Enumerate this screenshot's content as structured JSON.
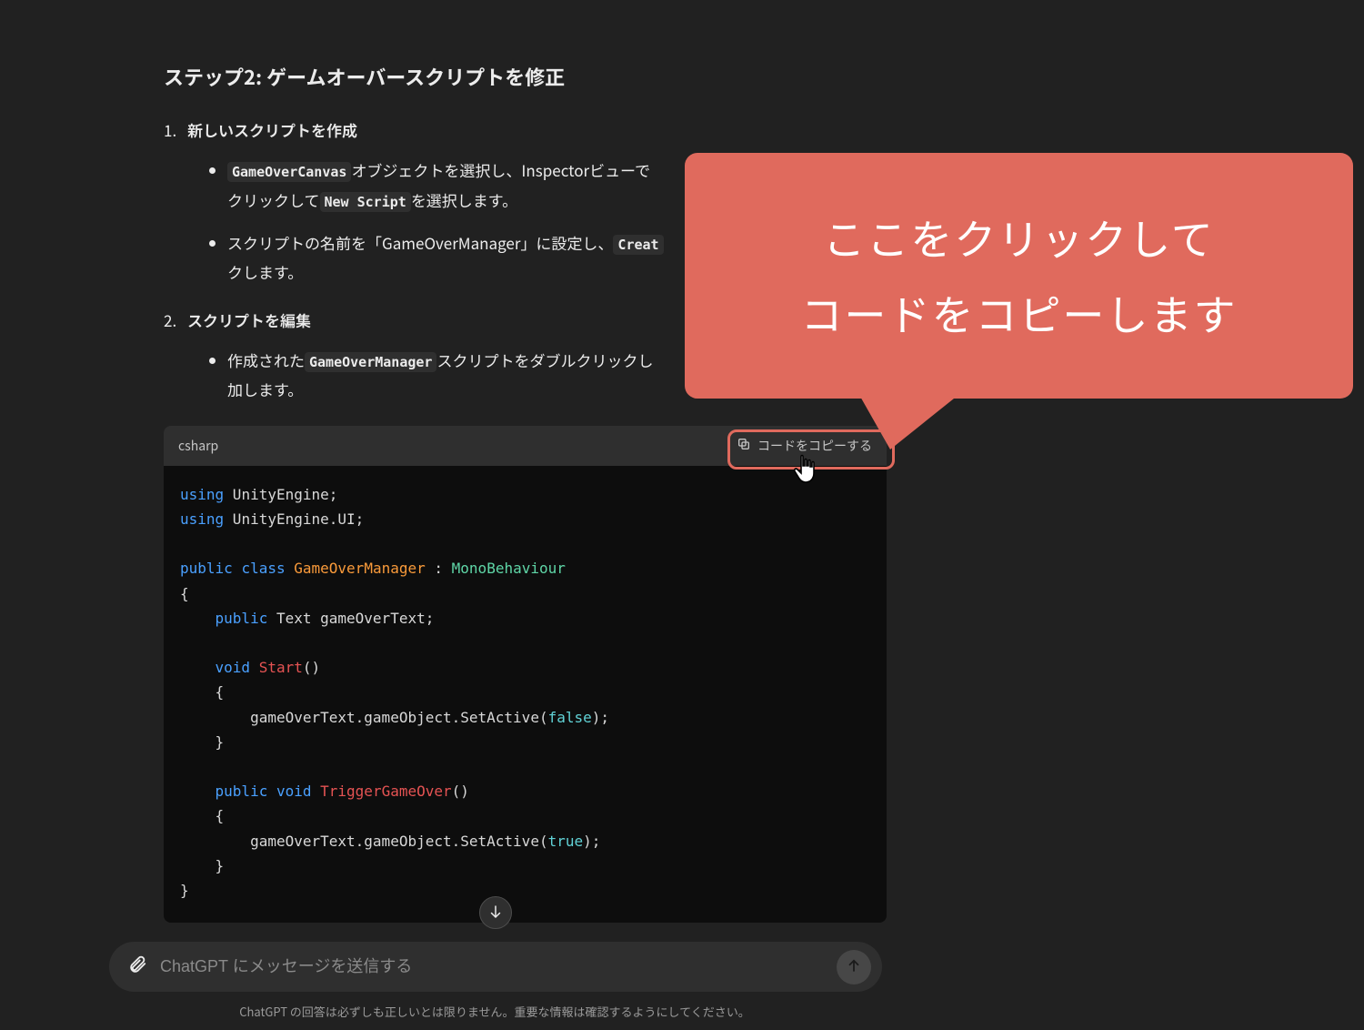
{
  "heading": "ステップ2: ゲームオーバースクリプトを修正",
  "steps": [
    {
      "title": "新しいスクリプトを作成",
      "bullets": [
        {
          "pre1": "",
          "code1": "GameOverCanvas",
          "mid1": "オブジェクトを選択し、Inspectorビューで",
          "line2pre": "クリックして",
          "code2": "New Script",
          "line2post": "を選択します。"
        },
        {
          "pre1": "スクリプトの名前を「GameOverManager」に設定し、",
          "code1": "Creat",
          "mid1": "",
          "line2pre": "クします。",
          "code2": "",
          "line2post": ""
        }
      ]
    },
    {
      "title": "スクリプトを編集",
      "bullets": [
        {
          "pre1": "作成された",
          "code1": "GameOverManager",
          "mid1": "スクリプトをダブルクリックし",
          "line2pre": "加します。",
          "code2": "",
          "line2post": ""
        }
      ]
    }
  ],
  "code": {
    "lang": "csharp",
    "copy_label": "コードをコピーする"
  },
  "callout": {
    "line1": "ここをクリックして",
    "line2": "コードをコピーします"
  },
  "input": {
    "placeholder": "ChatGPT にメッセージを送信する"
  },
  "footer": "ChatGPT の回答は必ずしも正しいとは限りません。重要な情報は確認するようにしてください。",
  "code_source": "using UnityEngine;\nusing UnityEngine.UI;\n\npublic class GameOverManager : MonoBehaviour\n{\n    public Text gameOverText;\n\n    void Start()\n    {\n        gameOverText.gameObject.SetActive(false);\n    }\n\n    public void TriggerGameOver()\n    {\n        gameOverText.gameObject.SetActive(true);\n    }\n}"
}
